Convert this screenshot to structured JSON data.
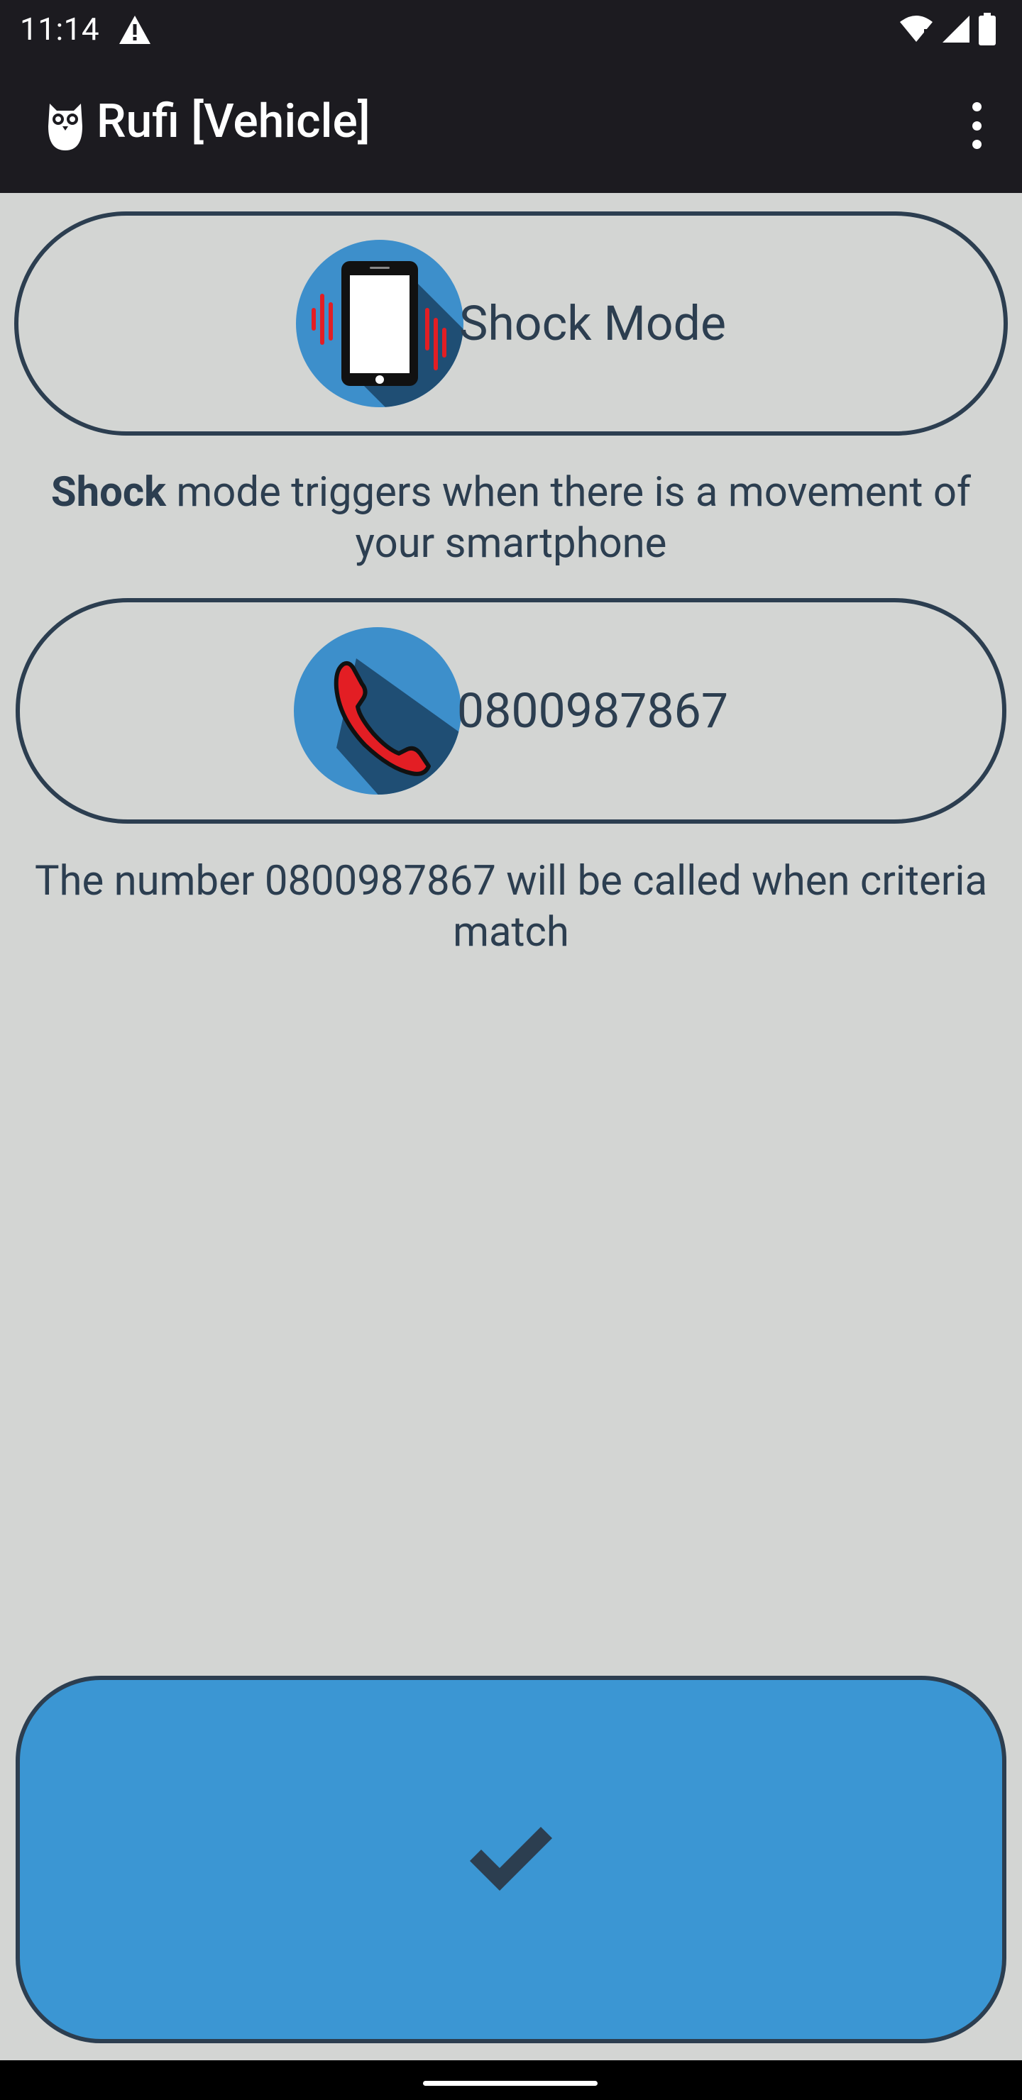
{
  "status_bar": {
    "time": "11:14",
    "icons": [
      "alert-icon",
      "wifi-icon",
      "signal-icon",
      "battery-icon"
    ]
  },
  "app_bar": {
    "title": "Rufi [Vehicle]",
    "logo": "owl-icon",
    "menu": "more-vert-icon"
  },
  "mode": {
    "label": "Shock Mode",
    "icon": "vibrating-phone-icon",
    "description_bold": "Shock",
    "description_rest": " mode triggers when there is a movement of your smartphone"
  },
  "phone": {
    "label": "0800987867",
    "icon": "phone-call-icon",
    "description": "The number 0800987867 will be called when criteria match"
  },
  "confirm": {
    "icon": "checkmark-icon"
  },
  "colors": {
    "background": "#d3d5d3",
    "bar": "#1c1b20",
    "text": "#2c3e50",
    "accent_blue": "#3b96d3",
    "icon_circle": "#3d8fcb",
    "icon_shadow": "#1f4e74",
    "alert_red": "#e31e24"
  }
}
